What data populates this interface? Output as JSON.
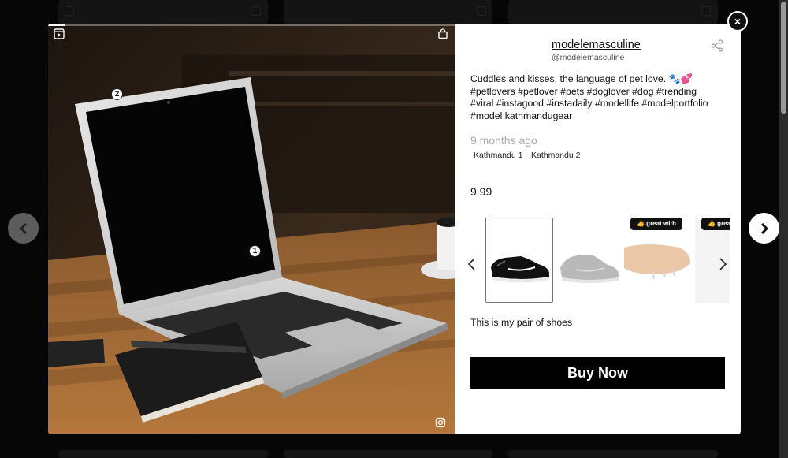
{
  "post": {
    "username": "modelemasculine",
    "handle": "@modelemasculine",
    "caption_line1": "Cuddles and kisses, the language of pet love. 🐾💕",
    "caption_line2": "#petlovers #petlover #pets #doglover #dog #trending",
    "caption_line3": "#viral #instagood #instadaily #modellife #modelportfolio",
    "caption_line4": "#model kathmandugear",
    "timestamp": "9 months ago",
    "locations": [
      "Kathmandu 1",
      "Kathmandu 2"
    ],
    "price": "9.99"
  },
  "media": {
    "hotspots": [
      "1",
      "2"
    ],
    "progress": 0.04
  },
  "products": {
    "badge_label": "👍 great with",
    "selected_description": "This is my pair of shoes",
    "items": [
      "shoe-black",
      "shoe-grey",
      "accessory-beige",
      "product-partial"
    ]
  },
  "actions": {
    "buy_label": "Buy Now",
    "close_label": "×"
  },
  "colors": {
    "buy_button": "#000000",
    "overlay": "#181818"
  },
  "icons": [
    "play-icon",
    "shopping-bag-icon",
    "instagram-icon",
    "share-icon",
    "chevron-left-icon",
    "chevron-right-icon",
    "close-icon"
  ]
}
